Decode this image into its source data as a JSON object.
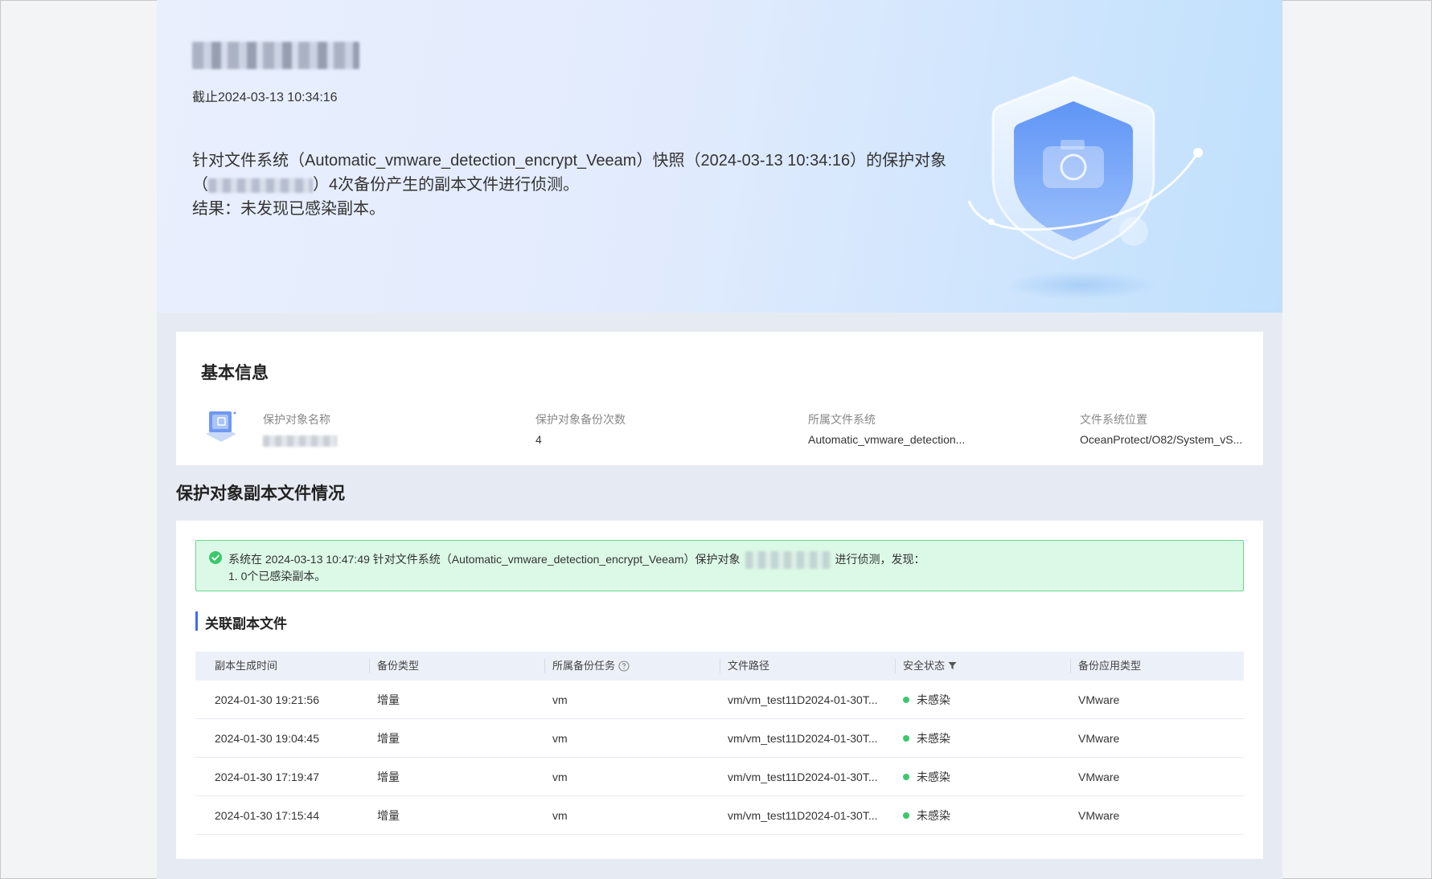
{
  "hero": {
    "cutoff_time": "截止2024-03-13 10:34:16",
    "desc_part1": "针对文件系统（Automatic_vmware_detection_encrypt_Veeam）快照（2024-03-13 10:34:16）的保护对象（",
    "desc_part2": "）4次备份产生的副本文件进行侦测。",
    "desc_result": "结果：未发现已感染副本。"
  },
  "basic_info": {
    "title": "基本信息",
    "fields": [
      {
        "label": "保护对象名称",
        "value": ""
      },
      {
        "label": "保护对象备份次数",
        "value": "4"
      },
      {
        "label": "所属文件系统",
        "value": "Automatic_vmware_detection..."
      },
      {
        "label": "文件系统位置",
        "value": "OceanProtect/O82/System_vS..."
      }
    ]
  },
  "copies_section": {
    "title": "保护对象副本文件情况",
    "alert": {
      "line1_part1": "系统在 2024-03-13 10:47:49 针对文件系统（Automatic_vmware_detection_encrypt_Veeam）保护对象",
      "line1_part2": "进行侦测，发现：",
      "line2": "1. 0个已感染副本。"
    },
    "related_title": "关联副本文件",
    "table": {
      "headers": [
        "副本生成时间",
        "备份类型",
        "所属备份任务",
        "文件路径",
        "安全状态",
        "备份应用类型"
      ],
      "rows": [
        [
          "2024-01-30 19:21:56",
          "增量",
          "vm",
          "vm/vm_test11D2024-01-30T...",
          "未感染",
          "VMware"
        ],
        [
          "2024-01-30 19:04:45",
          "增量",
          "vm",
          "vm/vm_test11D2024-01-30T...",
          "未感染",
          "VMware"
        ],
        [
          "2024-01-30 17:19:47",
          "增量",
          "vm",
          "vm/vm_test11D2024-01-30T...",
          "未感染",
          "VMware"
        ],
        [
          "2024-01-30 17:15:44",
          "增量",
          "vm",
          "vm/vm_test11D2024-01-30T...",
          "未感染",
          "VMware"
        ]
      ]
    }
  },
  "colors": {
    "accent": "#3d6bf5",
    "success": "#3cc76d",
    "alert_bg": "#dcf9e7",
    "page_bg": "#e6ebf3"
  },
  "icons": {
    "hero_illustration": "shield-camera-icon",
    "object_icon": "protected-object-icon",
    "alert_icon": "check-circle-icon",
    "help_icon": "question-circle-icon",
    "filter_icon": "filter-icon"
  }
}
